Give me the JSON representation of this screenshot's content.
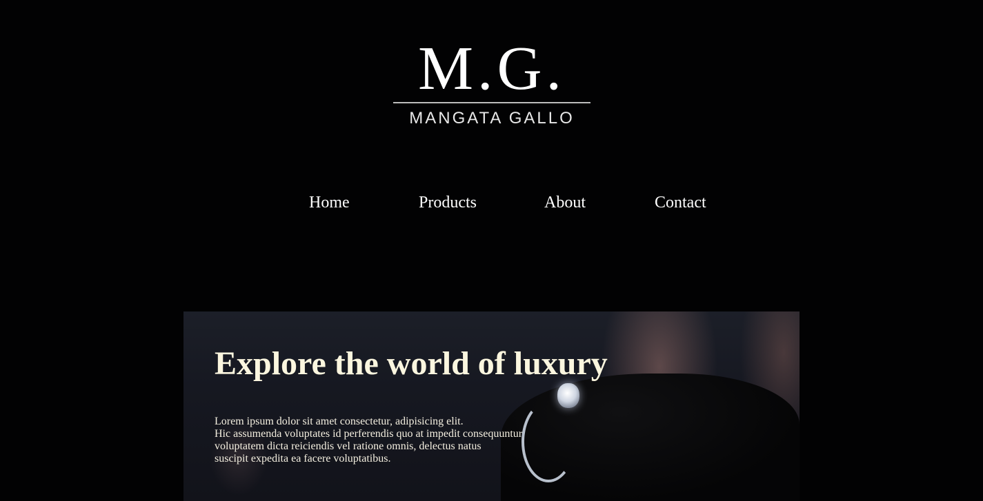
{
  "logo": {
    "mark": "M.G.",
    "name": "MANGATA GALLO"
  },
  "nav": [
    {
      "label": "Home"
    },
    {
      "label": "Products"
    },
    {
      "label": "About"
    },
    {
      "label": "Contact"
    }
  ],
  "hero": {
    "title": "Explore the world of luxury",
    "lines": [
      "Lorem ipsum dolor sit amet consectetur, adipisicing elit.",
      "Hic assumenda voluptates id perferendis quo at impedit consequuntur",
      "voluptatem dicta reiciendis vel ratione omnis, delectus natus",
      "suscipit expedita ea facere voluptatibus."
    ]
  }
}
